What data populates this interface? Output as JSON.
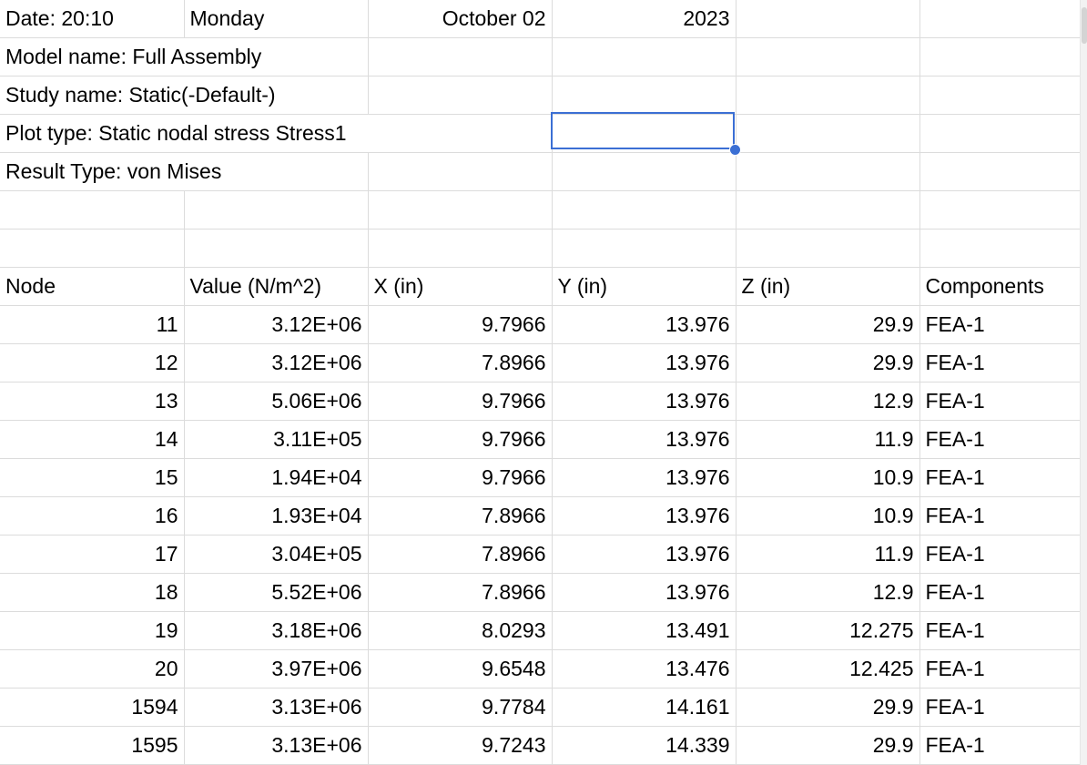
{
  "rows": [
    [
      "Date:  20:10",
      "Monday",
      "October 02",
      "2023",
      "",
      ""
    ],
    [
      "Model name: Full Assembly",
      "",
      "",
      "",
      "",
      ""
    ],
    [
      "Study name: Static(-Default-)",
      "",
      "",
      "",
      "",
      ""
    ],
    [
      "Plot type: Static nodal stress Stress1",
      "",
      "",
      "",
      "",
      ""
    ],
    [
      "Result Type: von Mises",
      "",
      "",
      "",
      "",
      ""
    ],
    [
      "",
      "",
      "",
      "",
      "",
      ""
    ],
    [
      "",
      "",
      "",
      "",
      "",
      ""
    ],
    [
      "Node",
      "Value (N/m^2)",
      "X (in)",
      "Y (in)",
      "Z (in)",
      "Components"
    ],
    [
      "11",
      "3.12E+06",
      "9.7966",
      "13.976",
      "29.9",
      "FEA-1"
    ],
    [
      "12",
      "3.12E+06",
      "7.8966",
      "13.976",
      "29.9",
      "FEA-1"
    ],
    [
      "13",
      "5.06E+06",
      "9.7966",
      "13.976",
      "12.9",
      "FEA-1"
    ],
    [
      "14",
      "3.11E+05",
      "9.7966",
      "13.976",
      "11.9",
      "FEA-1"
    ],
    [
      "15",
      "1.94E+04",
      "9.7966",
      "13.976",
      "10.9",
      "FEA-1"
    ],
    [
      "16",
      "1.93E+04",
      "7.8966",
      "13.976",
      "10.9",
      "FEA-1"
    ],
    [
      "17",
      "3.04E+05",
      "7.8966",
      "13.976",
      "11.9",
      "FEA-1"
    ],
    [
      "18",
      "5.52E+06",
      "7.8966",
      "13.976",
      "12.9",
      "FEA-1"
    ],
    [
      "19",
      "3.18E+06",
      "8.0293",
      "13.491",
      "12.275",
      "FEA-1"
    ],
    [
      "20",
      "3.97E+06",
      "9.6548",
      "13.476",
      "12.425",
      "FEA-1"
    ],
    [
      "1594",
      "3.13E+06",
      "9.7784",
      "14.161",
      "29.9",
      "FEA-1"
    ],
    [
      "1595",
      "3.13E+06",
      "9.7243",
      "14.339",
      "29.9",
      "FEA-1"
    ],
    [
      "",
      "",
      "",
      "",
      "",
      ""
    ]
  ],
  "align": [
    [
      "txt",
      "txt",
      "num",
      "num",
      "txt",
      "txt"
    ],
    [
      "txt",
      "txt",
      "txt",
      "txt",
      "txt",
      "txt"
    ],
    [
      "txt",
      "txt",
      "txt",
      "txt",
      "txt",
      "txt"
    ],
    [
      "txt",
      "txt",
      "txt",
      "txt",
      "txt",
      "txt"
    ],
    [
      "txt",
      "txt",
      "txt",
      "txt",
      "txt",
      "txt"
    ],
    [
      "txt",
      "txt",
      "txt",
      "txt",
      "txt",
      "txt"
    ],
    [
      "txt",
      "txt",
      "txt",
      "txt",
      "txt",
      "txt"
    ],
    [
      "txt",
      "txt",
      "txt",
      "txt",
      "txt",
      "txt"
    ],
    [
      "num",
      "num",
      "num",
      "num",
      "num",
      "txt"
    ]
  ],
  "selection": {
    "row": 4,
    "col": 4
  },
  "colors": {
    "gridline": "#dcdcdc",
    "selection": "#3b6fd4"
  }
}
